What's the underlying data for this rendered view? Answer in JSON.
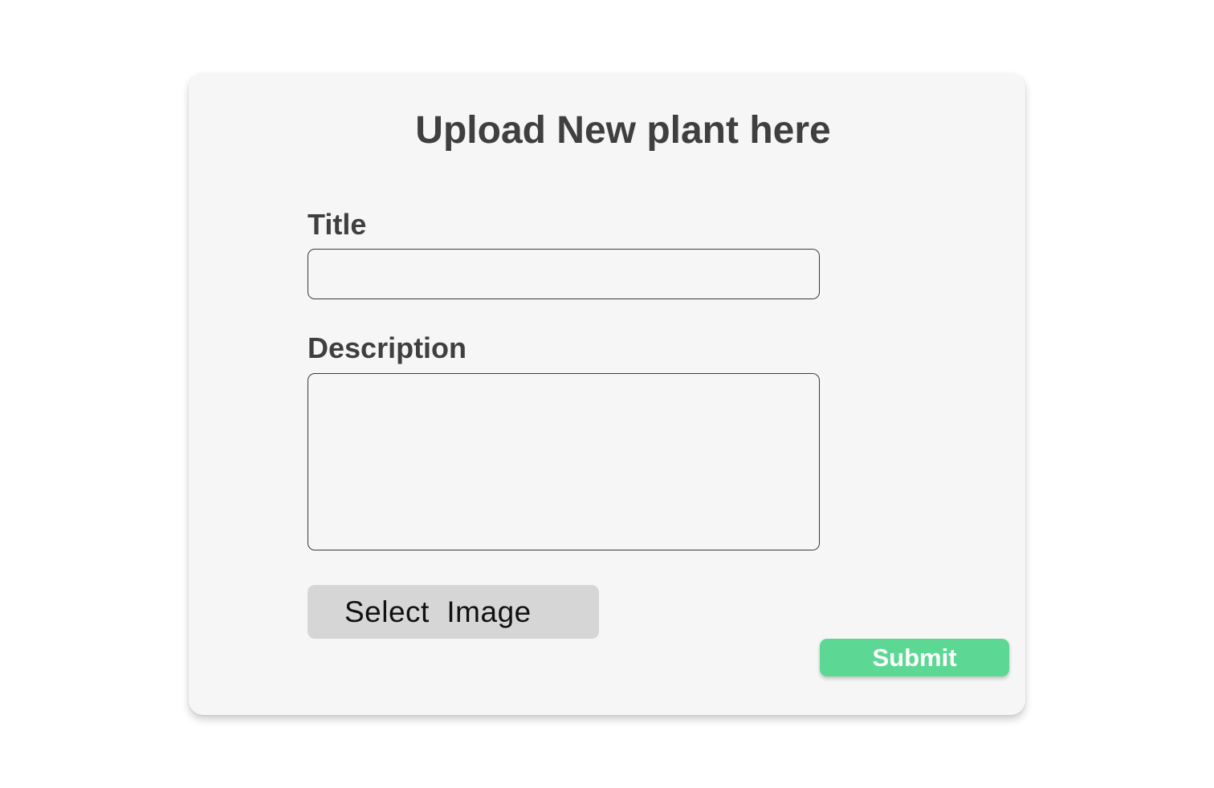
{
  "form": {
    "heading": "Upload New plant here",
    "title_label": "Title",
    "title_value": "",
    "description_label": "Description",
    "description_value": "",
    "select_image_label": "Select  Image",
    "submit_label": "Submit"
  },
  "colors": {
    "card_background": "#f6f6f6",
    "text_dark": "#3f3f3f",
    "select_button": "#d6d6d6",
    "submit_button": "#5cd894",
    "submit_text": "#ffffff"
  }
}
